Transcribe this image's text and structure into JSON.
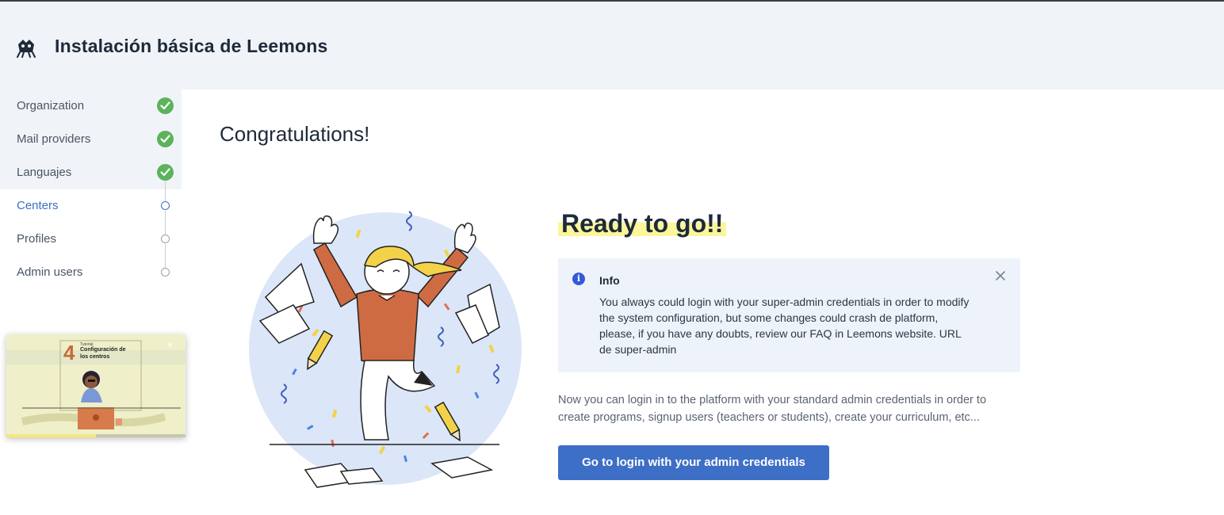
{
  "header": {
    "title": "Instalación básica de Leemons",
    "logo_icon": "leemons-logo-icon"
  },
  "sidebar": {
    "steps": [
      {
        "label": "Organization",
        "status": "completed"
      },
      {
        "label": "Mail providers",
        "status": "completed"
      },
      {
        "label": "Languajes",
        "status": "completed"
      },
      {
        "label": "Centers",
        "status": "active"
      },
      {
        "label": "Profiles",
        "status": "pending"
      },
      {
        "label": "Admin users",
        "status": "pending"
      }
    ],
    "video": {
      "number": "4",
      "kicker": "Tutorial",
      "title_line1": "Configuración de",
      "title_line2": "los centros",
      "close": "×",
      "progress": 0.5
    }
  },
  "main": {
    "heading": "Congratulations!",
    "ready_title": "Ready to go!!",
    "info": {
      "title": "Info",
      "text": "You always could login with your super-admin credentials in order to modify the system configuration, but some changes could crash de platform, please, if you have any doubts, review our FAQ in Leemons website. URL de super-admin",
      "close_icon": "close-icon"
    },
    "description": "Now you can login in to the platform with your standard admin credentials in order to create programs, signup users (teachers or students), create your curriculum, etc...",
    "cta_label": "Go to login with your admin credentials"
  },
  "colors": {
    "accent": "#3e6fc6",
    "success": "#5bb35b",
    "highlight": "#fbf69a",
    "info_bg": "#eef3fb"
  }
}
